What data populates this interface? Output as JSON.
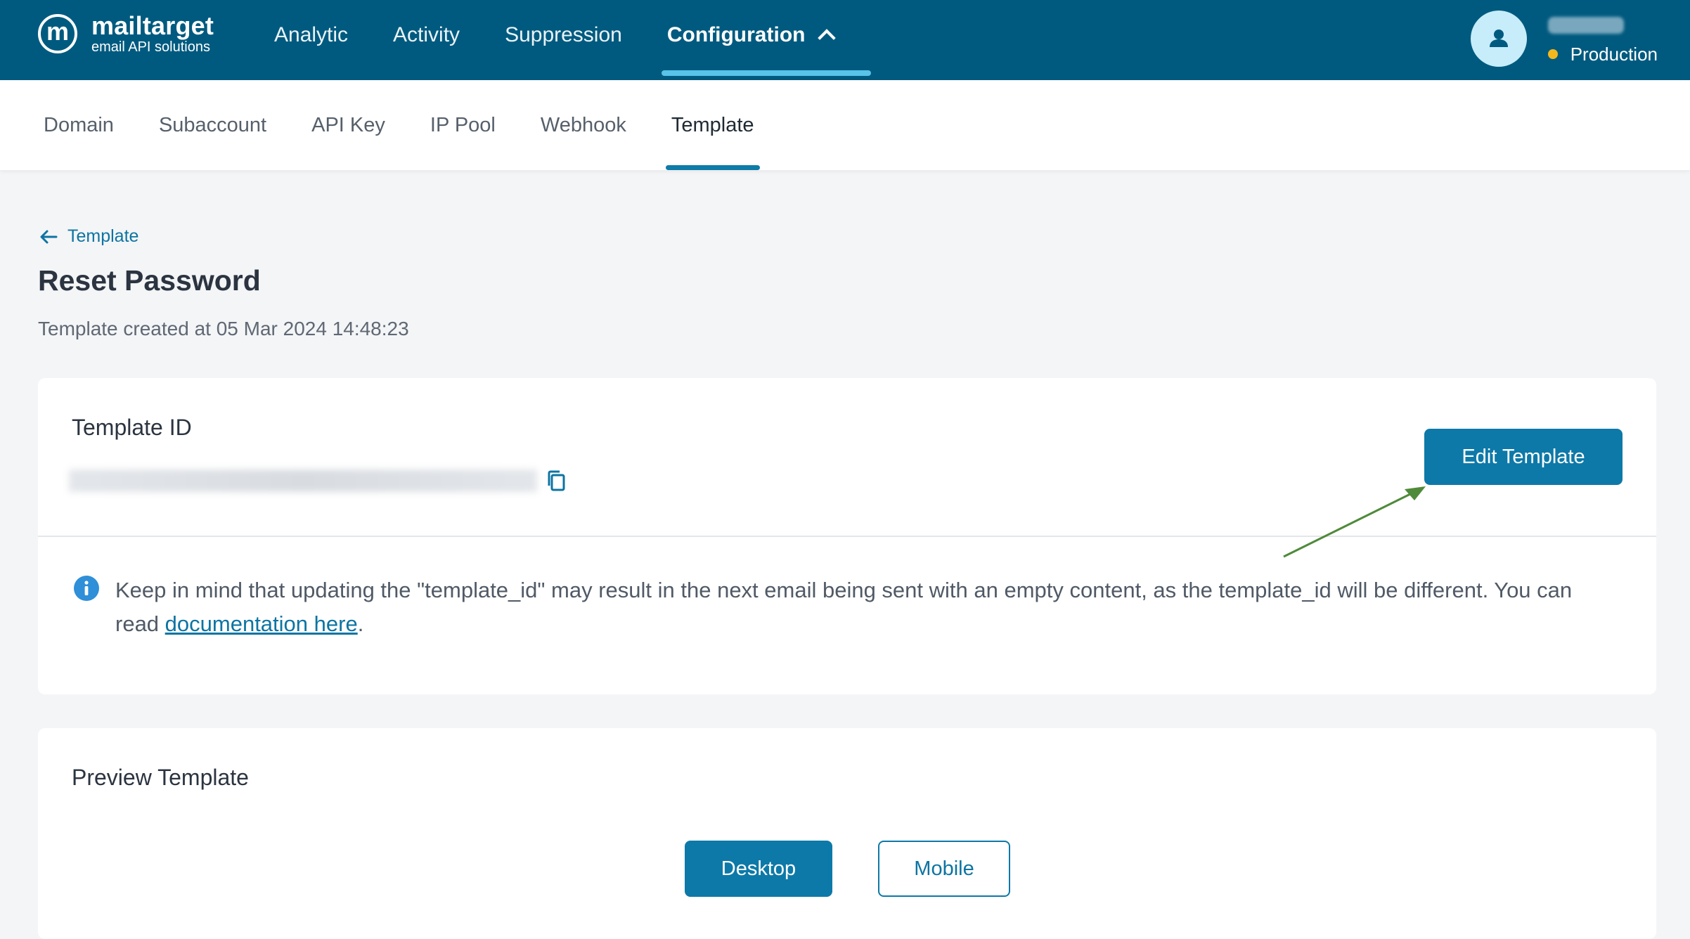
{
  "brand": {
    "mark": "m",
    "name": "mailtarget",
    "tagline": "email API solutions"
  },
  "main_nav": {
    "items": [
      {
        "label": "Analytic"
      },
      {
        "label": "Activity"
      },
      {
        "label": "Suppression"
      },
      {
        "label": "Configuration"
      }
    ],
    "active": "Configuration"
  },
  "account": {
    "name": "",
    "environment": "Production",
    "environment_color": "#f5b81c"
  },
  "sub_nav": {
    "items": [
      {
        "label": "Domain"
      },
      {
        "label": "Subaccount"
      },
      {
        "label": "API Key"
      },
      {
        "label": "IP Pool"
      },
      {
        "label": "Webhook"
      },
      {
        "label": "Template"
      }
    ],
    "active": "Template"
  },
  "page": {
    "back_label": "Template",
    "title": "Reset Password",
    "subtitle": "Template created at 05 Mar 2024 14:48:23"
  },
  "template_id_card": {
    "label": "Template ID",
    "value": "",
    "edit_button": "Edit Template",
    "notice_text": "Keep in mind that updating the \"template_id\" may result in the next email being sent with an empty content, as the template_id will be different. You can read ",
    "notice_link": "documentation here",
    "notice_end": "."
  },
  "preview_card": {
    "label": "Preview Template",
    "desktop_button": "Desktop",
    "mobile_button": "Mobile"
  },
  "colors": {
    "header_bg": "#005a7f",
    "accent": "#0d79a8",
    "nav_underline": "#59c3e8",
    "annotation_arrow": "#4f8a3a"
  }
}
